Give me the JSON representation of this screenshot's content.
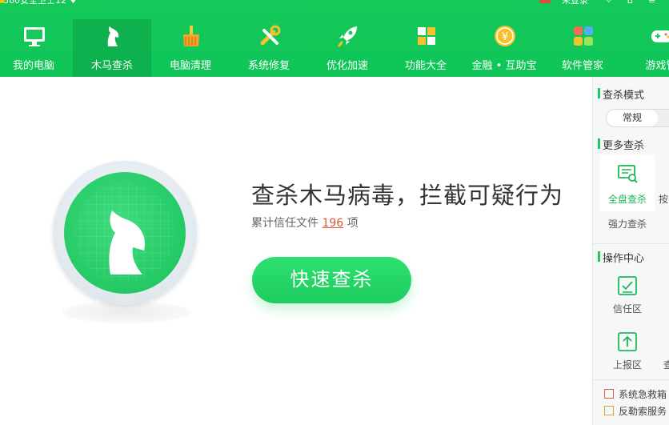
{
  "titlebar": {
    "app_title": "360安全卫士12 ♦",
    "login": "未登录",
    "icons": [
      "gift-icon",
      "settings-icon",
      "home-icon",
      "menu-icon"
    ]
  },
  "nav": [
    {
      "label": "我的电脑",
      "icon": "monitor-icon"
    },
    {
      "label": "木马查杀",
      "icon": "horse-icon",
      "active": true
    },
    {
      "label": "电脑清理",
      "icon": "broom-icon"
    },
    {
      "label": "系统修复",
      "icon": "wrench-icon"
    },
    {
      "label": "优化加速",
      "icon": "rocket-icon"
    },
    {
      "label": "功能大全",
      "icon": "grid-icon"
    },
    {
      "label": "金融 • 互助宝",
      "icon": "yuan-coin-icon"
    },
    {
      "label": "软件管家",
      "icon": "apps-icon"
    },
    {
      "label": "游戏管",
      "icon": "gamepad-icon"
    }
  ],
  "main": {
    "headline": "查杀木马病毒，拦截可疑行为",
    "sub_prefix": "累计信任文件",
    "sub_count": "196",
    "sub_suffix": "项",
    "scan_button": "快速查杀"
  },
  "side": {
    "mode_title": "查杀模式",
    "mode_option": "常规",
    "more_title": "更多查杀",
    "more_tiles": [
      {
        "label": "全盘查杀",
        "icon": "disk-scan-icon",
        "active": true
      },
      {
        "label": "强力查杀",
        "icon": ""
      }
    ],
    "more_cut": "按",
    "ops_title": "操作中心",
    "ops_tiles": [
      {
        "label": "信任区",
        "icon": "trust-zone-icon"
      },
      {
        "label": "上报区",
        "icon": "upload-zone-icon"
      }
    ],
    "ops_cut": "查",
    "links": [
      "系统急救箱",
      "反勒索服务"
    ]
  },
  "colors": {
    "brand": "#14c95a",
    "accent_text": "#1cb955",
    "count": "#e0553d"
  }
}
